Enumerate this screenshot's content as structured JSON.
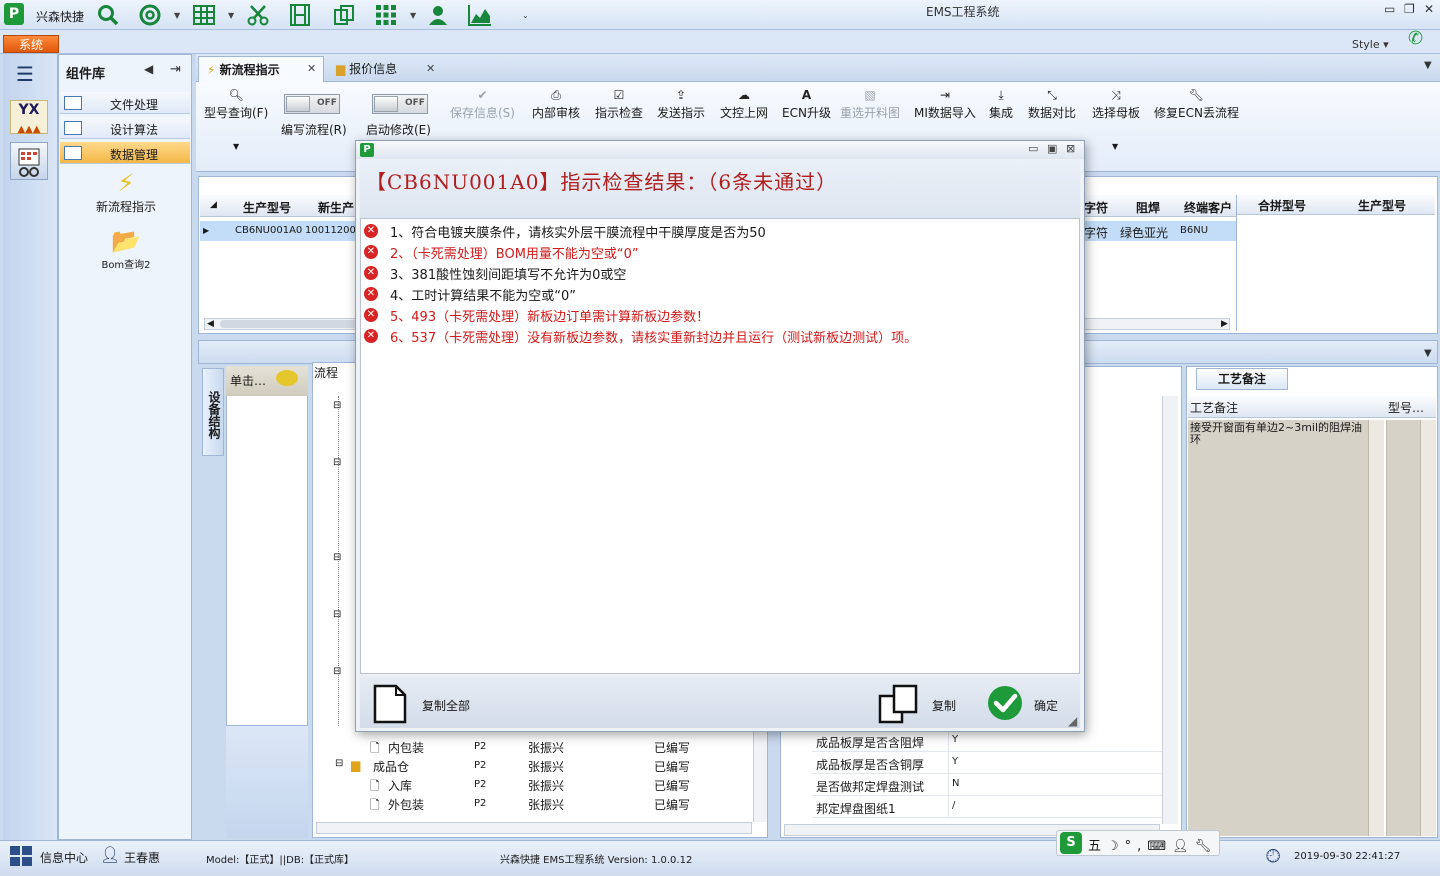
{
  "app": {
    "name": "兴森快捷",
    "window_title": "EMS工程系统",
    "system_tab": "系统",
    "style_label": "Style"
  },
  "leftrail": {
    "app1_label": "YX"
  },
  "complib": {
    "title": "组件库",
    "categories": [
      {
        "label": "文件处理",
        "active": false
      },
      {
        "label": "设计算法",
        "active": false
      },
      {
        "label": "数据管理",
        "active": true
      }
    ],
    "tools": [
      {
        "label": "新流程指示",
        "icon": "lightning-icon"
      },
      {
        "label": "Bom查询2",
        "icon": "folder-icon"
      }
    ]
  },
  "tabs": [
    {
      "label": "新流程指示",
      "active": true
    },
    {
      "label": "报价信息",
      "active": false
    }
  ],
  "ribbon": {
    "model_query": "型号查询(F)",
    "write_flow_toggle": "OFF",
    "write_flow_label": "编写流程(R)",
    "start_modify_toggle": "OFF",
    "start_modify_label": "启动修改(E)",
    "buttons": [
      {
        "label": "保存信息(S)",
        "icon": "check-icon",
        "disabled": true
      },
      {
        "label": "内部审核",
        "icon": "print-icon",
        "disabled": false
      },
      {
        "label": "指示检查",
        "icon": "checkbox-icon",
        "disabled": false
      },
      {
        "label": "发送指示",
        "icon": "upload-icon",
        "disabled": false
      },
      {
        "label": "文控上网",
        "icon": "cloud-icon",
        "disabled": false
      },
      {
        "label": "ECN升级",
        "icon": "font-icon",
        "disabled": false
      },
      {
        "label": "重选开料图",
        "icon": "image-icon",
        "disabled": true
      },
      {
        "label": "MI数据导入",
        "icon": "import-icon",
        "disabled": false
      },
      {
        "label": "集成",
        "icon": "download-icon",
        "disabled": false
      },
      {
        "label": "数据对比",
        "icon": "compress-icon",
        "disabled": false
      },
      {
        "label": "选择母板",
        "icon": "shuffle-icon",
        "disabled": false
      },
      {
        "label": "修复ECN丢流程",
        "icon": "wrench-icon",
        "disabled": false
      }
    ]
  },
  "grid": {
    "headers_left": [
      "生产型号",
      "新生产"
    ],
    "headers_right": [
      "字符",
      "阻焊",
      "终端客户"
    ],
    "row": {
      "model": "CB6NU001A0",
      "new_model": "100112000",
      "silkscreen": "字符",
      "soldermask": "绿色亚光",
      "customer": "B6NU"
    },
    "side_headers": [
      "合拼型号",
      "生产型号"
    ]
  },
  "lower": {
    "vtab_label": "设备结构",
    "click_hint": "单击…",
    "flow_head": "流程",
    "flow_rows": [
      {
        "name": "内包装",
        "code": "P2",
        "person": "张振兴",
        "status": "已编写",
        "folder": false
      },
      {
        "name": "成品仓",
        "code": "P2",
        "person": "张振兴",
        "status": "已编写",
        "folder": true
      },
      {
        "name": "入库",
        "code": "P2",
        "person": "张振兴",
        "status": "已编写",
        "folder": false
      },
      {
        "name": "外包装",
        "code": "P2",
        "person": "张振兴",
        "status": "已编写",
        "folder": false
      }
    ],
    "props": [
      {
        "key": "成品板厚是否含阻焊",
        "value": "Y"
      },
      {
        "key": "成品板厚是否含铜厚",
        "value": "Y"
      },
      {
        "key": "是否做邦定焊盘测试",
        "value": "N"
      },
      {
        "key": "邦定焊盘图纸1",
        "value": "/"
      }
    ],
    "craft_tab": "工艺备注",
    "craft_col_note": "工艺备注",
    "craft_col_type": "型号…",
    "craft_note": "接受开窗面有单边2~3mil的阻焊油环"
  },
  "dialog": {
    "title": "【CB6NU001A0】指示检查结果：（6条未通过）",
    "errors": [
      {
        "text": "1、符合电镀夹膜条件，请核实外层干膜流程中干膜厚度是否为50",
        "red": false
      },
      {
        "text": "2、（卡死需处理）BOM用量不能为空或“0”",
        "red": true
      },
      {
        "text": "3、381酸性蚀刻间距填写不允许为0或空",
        "red": false
      },
      {
        "text": "4、工时计算结果不能为空或“0”",
        "red": false
      },
      {
        "text": "5、493（卡死需处理）新板边订单需计算新板边参数！",
        "red": true
      },
      {
        "text": "6、537（卡死需处理）没有新板边参数，请核实重新封边并且运行（测试新板边测试）项。",
        "red": true
      }
    ],
    "copy_all": "复制全部",
    "copy": "复制",
    "ok": "确定"
  },
  "statusbar": {
    "info_center": "信息中心",
    "user": "王春惠",
    "model_db": "Model:【正式】||DB:【正式库】",
    "version": "兴森快捷 EMS工程系统 Version: 1.0.0.12",
    "ime_label": "五",
    "datetime": "2019-09-30 22:41:27"
  },
  "colors": {
    "accent_orange": "#e0580b",
    "error_red": "#d11a1a",
    "success_green": "#1f9a3a",
    "selected_row": "#c3dcf7"
  }
}
